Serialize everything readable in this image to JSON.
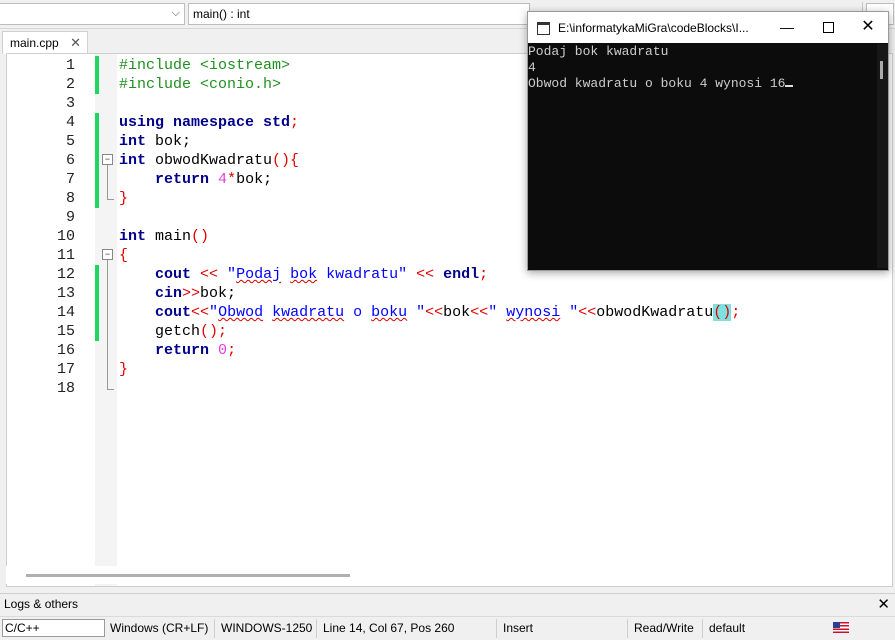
{
  "toolbar": {
    "scope_combo": "",
    "function_combo": "main() : int"
  },
  "tabs": [
    {
      "label": "main.cpp",
      "close": "✕"
    }
  ],
  "editor": {
    "line_numbers": [
      "1",
      "2",
      "3",
      "4",
      "5",
      "6",
      "7",
      "8",
      "9",
      "10",
      "11",
      "12",
      "13",
      "14",
      "15",
      "16",
      "17",
      "18"
    ]
  },
  "console": {
    "title": "E:\\informatykaMiGra\\codeBlocks\\I...",
    "minimize": "—",
    "close": "✕",
    "output": [
      "Podaj bok kwadratu",
      "4",
      "Obwod kwadratu o boku 4 wynosi 16"
    ]
  },
  "logs": {
    "label": "Logs & others",
    "close": "✕"
  },
  "status": {
    "language": "C/C++",
    "line_endings": "Windows (CR+LF)",
    "encoding": "WINDOWS-1250",
    "position": "Line 14, Col 67, Pos 260",
    "mode": "Insert",
    "access": "Read/Write",
    "profile": "default"
  },
  "code": {
    "l1": "#include <iostream>",
    "l2": "#include <conio.h>",
    "l4_kw": "using namespace std",
    "l4_semi": ";",
    "l5_kw": "int",
    "l5_rest": " bok;",
    "l6_kw": "int",
    "l6_name": " obwodKwadratu",
    "l6_par": "(){",
    "l7_ind": "    ",
    "l7_kw": "return",
    "l7_sp": " ",
    "l7_num": "4",
    "l7_op": "*",
    "l7_rest": "bok;",
    "l8": "}",
    "l10_kw": "int",
    "l10_name": " main",
    "l10_par": "()",
    "l11": "{",
    "l12_ind": "    ",
    "l12_cout": "cout",
    "l12_op1": " << ",
    "l12_q1": "\"",
    "l12_w1": "Podaj",
    "l12_s1": " ",
    "l12_w2": "bok",
    "l12_s2": " kwadratu\"",
    "l12_op2": " << ",
    "l12_endl": "endl",
    "l12_semi": ";",
    "l13_ind": "    ",
    "l13_cin": "cin",
    "l13_op": ">>",
    "l13_rest": "bok;",
    "l14_ind": "    ",
    "l14_cout": "cout",
    "l14_op1": "<<",
    "l14_q1": "\"",
    "l14_w1": "Obwod",
    "l14_s1": " ",
    "l14_w2": "kwadratu",
    "l14_s2": " o ",
    "l14_w3": "boku",
    "l14_s3": " \"",
    "l14_op2": "<<",
    "l14_bok": "bok",
    "l14_op3": "<<",
    "l14_s4": "\" ",
    "l14_w4": "wynosi",
    "l14_s5": " \"",
    "l14_op4": "<<",
    "l14_fn": "obwodKwadratu",
    "l14_par": "()",
    "l14_semi": ";",
    "l15_ind": "    ",
    "l15_fn": "getch",
    "l15_par": "()",
    "l15_semi": ";",
    "l16_ind": "    ",
    "l16_kw": "return",
    "l16_sp": " ",
    "l16_num": "0",
    "l16_semi": ";",
    "l17": "}"
  },
  "colors": {
    "preprocessor": "#209020",
    "keyword": "#00008b",
    "number": "#e040e0",
    "string": "#0000ff",
    "operator": "#e00000",
    "changebar": "#1ed760",
    "brace_match": "#7fe0e0"
  }
}
